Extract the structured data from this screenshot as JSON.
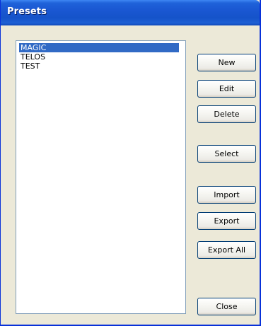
{
  "window": {
    "title": "Presets"
  },
  "presets": {
    "items": [
      "MAGIC",
      "TELOS",
      "TEST"
    ],
    "selected": "MAGIC"
  },
  "buttons": {
    "new": "New",
    "edit": "Edit",
    "delete": "Delete",
    "select": "Select",
    "import": "Import",
    "export": "Export",
    "export_all": "Export All",
    "close": "Close"
  },
  "colors": {
    "titlebar": "#1553c9",
    "dialog_background": "#ece9d8",
    "selection": "#316ac5",
    "button_border": "#003c74"
  }
}
